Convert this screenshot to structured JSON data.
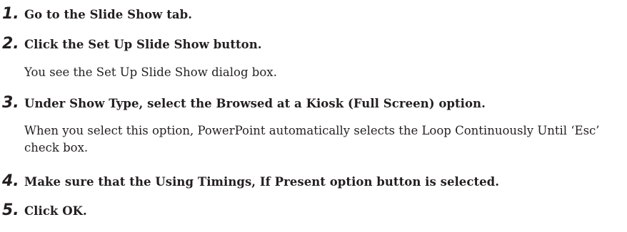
{
  "steps": [
    {
      "number": "1.",
      "text": "Go to the Slide Show tab.",
      "note": ""
    },
    {
      "number": "2.",
      "text": "Click the Set Up Slide Show button.",
      "note": "You see the Set Up Slide Show dialog box."
    },
    {
      "number": "3.",
      "text": "Under Show Type, select the Browsed at a Kiosk (Full Screen) option.",
      "note": "When you select this option, PowerPoint automatically selects the Loop Continuously Until ‘Esc’ check box."
    },
    {
      "number": "4.",
      "text": "Make sure that the Using Timings, If Present option button is selected.",
      "note": ""
    },
    {
      "number": "5.",
      "text": "Click OK.",
      "note": ""
    }
  ]
}
